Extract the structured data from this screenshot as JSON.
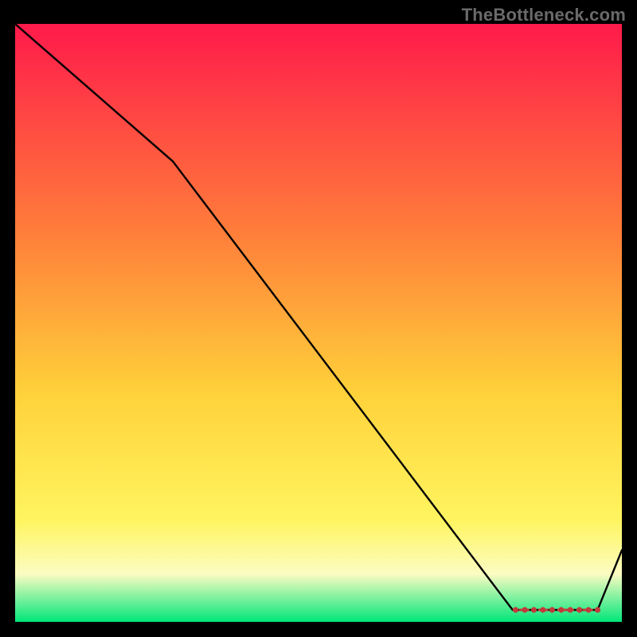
{
  "watermark": "TheBottleneck.com",
  "colors": {
    "grad_top": "#ff1a4b",
    "grad_mid_top": "#ff7e3a",
    "grad_mid": "#ffd23a",
    "grad_low": "#fff560",
    "grad_pale": "#fcfcc2",
    "grad_green": "#00e67a",
    "line": "#000000",
    "marker": "#c23a3a",
    "bg": "#000000"
  },
  "chart_data": {
    "type": "line",
    "title": "",
    "xlabel": "",
    "ylabel": "",
    "xlim": [
      0,
      100
    ],
    "ylim": [
      0,
      100
    ],
    "x": [
      0,
      26,
      82,
      90,
      96,
      100
    ],
    "y": [
      100,
      77,
      2,
      2,
      2,
      12
    ],
    "flat_region": {
      "x_start": 82,
      "x_end": 96,
      "y": 2
    },
    "markers": {
      "x": [
        82.5,
        84.0,
        85.5,
        87.0,
        88.5,
        90.0,
        91.5,
        93.0,
        94.5,
        96.0
      ],
      "y": [
        2,
        2,
        2,
        2,
        2,
        2,
        2,
        2,
        2,
        2
      ]
    }
  }
}
